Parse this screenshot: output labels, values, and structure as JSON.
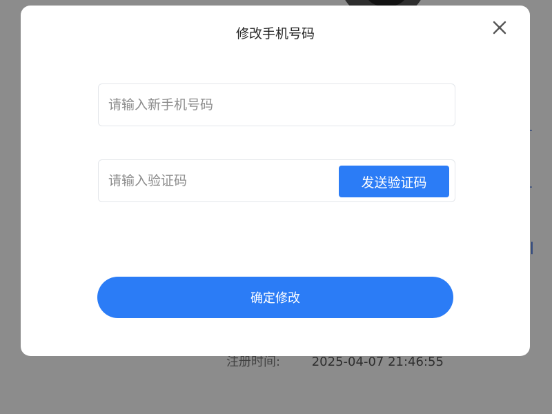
{
  "modal": {
    "title": "修改手机号码",
    "phone_input": {
      "placeholder": "请输入新手机号码",
      "value": ""
    },
    "code_input": {
      "placeholder": "请输入验证码",
      "value": ""
    },
    "send_code_label": "发送验证码",
    "confirm_label": "确定修改"
  },
  "background": {
    "register_label": "注册时间:",
    "register_time": "2025-04-07 21:46:55"
  },
  "colors": {
    "accent": "#2b7cf6",
    "overlay": "rgba(0,0,0,0.45)"
  },
  "icons": {
    "close": "close-icon"
  }
}
